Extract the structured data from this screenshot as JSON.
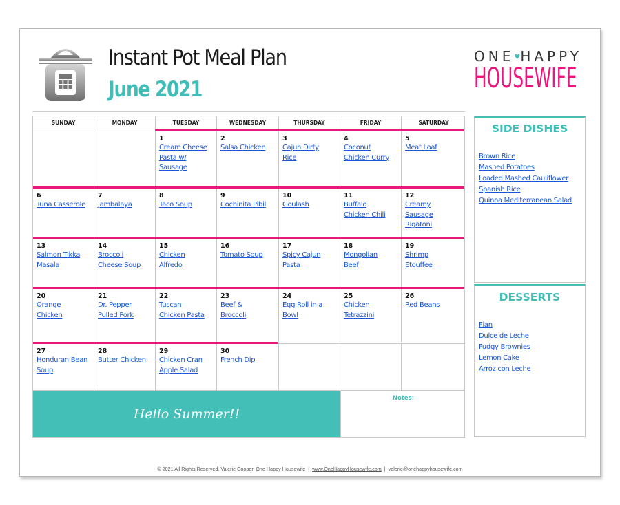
{
  "header": {
    "title": "Instant Pot Meal Plan",
    "subtitle": "June 2021",
    "icon": "instant-pot-icon"
  },
  "logo": {
    "top_left": "ONE",
    "top_right": "HAPPY",
    "heart": "♥",
    "bottom": "HOUSEWIFE"
  },
  "colors": {
    "teal": "#3fbdb6",
    "pink": "#e8187f",
    "link": "#1a56d6"
  },
  "calendar": {
    "days": [
      "SUNDAY",
      "MONDAY",
      "TUESDAY",
      "WEDNESDAY",
      "THURSDAY",
      "FRIDAY",
      "SATURDAY"
    ],
    "weeks": [
      [
        {
          "day": "",
          "meals": []
        },
        {
          "day": "",
          "meals": []
        },
        {
          "day": "1",
          "meals": [
            "Cream Cheese",
            "Pasta w/",
            "Sausage"
          ]
        },
        {
          "day": "2",
          "meals": [
            "Salsa Chicken"
          ]
        },
        {
          "day": "3",
          "meals": [
            "Cajun Dirty",
            "Rice"
          ]
        },
        {
          "day": "4",
          "meals": [
            "Coconut",
            "Chicken Curry"
          ]
        },
        {
          "day": "5",
          "meals": [
            "Meat Loaf"
          ]
        }
      ],
      [
        {
          "day": "6",
          "meals": [
            "Tuna Casserole"
          ]
        },
        {
          "day": "7",
          "meals": [
            "Jambalaya"
          ]
        },
        {
          "day": "8",
          "meals": [
            "Taco Soup"
          ]
        },
        {
          "day": "9",
          "meals": [
            "Cochinita Pibil"
          ]
        },
        {
          "day": "10",
          "meals": [
            "Goulash"
          ]
        },
        {
          "day": "11",
          "meals": [
            "Buffalo",
            "Chicken Chili"
          ]
        },
        {
          "day": "12",
          "meals": [
            "Creamy",
            "Sausage",
            "Rigatoni"
          ]
        }
      ],
      [
        {
          "day": "13",
          "meals": [
            "Salmon Tikka",
            "Masala"
          ]
        },
        {
          "day": "14",
          "meals": [
            "Broccoli",
            "Cheese Soup"
          ]
        },
        {
          "day": "15",
          "meals": [
            "Chicken",
            "Alfredo"
          ]
        },
        {
          "day": "16",
          "meals": [
            "Tomato Soup"
          ]
        },
        {
          "day": "17",
          "meals": [
            "Spicy Cajun",
            "Pasta"
          ]
        },
        {
          "day": "18",
          "meals": [
            "Mongolian",
            "Beef"
          ]
        },
        {
          "day": "19",
          "meals": [
            "Shrimp",
            "Etouffee"
          ]
        }
      ],
      [
        {
          "day": "20",
          "meals": [
            "Orange",
            "Chicken"
          ]
        },
        {
          "day": "21",
          "meals": [
            "Dr. Pepper",
            "Pulled Pork"
          ]
        },
        {
          "day": "22",
          "meals": [
            "Tuscan",
            "Chicken Pasta"
          ]
        },
        {
          "day": "23",
          "meals": [
            "Beef &",
            "Broccoli"
          ]
        },
        {
          "day": "24",
          "meals": [
            "Egg Roll in a",
            "Bowl"
          ]
        },
        {
          "day": "25",
          "meals": [
            "Chicken",
            "Tetrazzini"
          ]
        },
        {
          "day": "26",
          "meals": [
            "Red Beans"
          ]
        }
      ],
      [
        {
          "day": "27",
          "meals": [
            "Honduran Bean",
            "Soup"
          ]
        },
        {
          "day": "28",
          "meals": [
            "Butter Chicken"
          ]
        },
        {
          "day": "29",
          "meals": [
            "Chicken Cran",
            "Apple Salad"
          ]
        },
        {
          "day": "30",
          "meals": [
            "French Dip"
          ]
        },
        {
          "day": "",
          "meals": []
        },
        {
          "day": "",
          "meals": []
        },
        {
          "day": "",
          "meals": []
        }
      ]
    ],
    "banner": "Hello Summer!!",
    "notes_label": "Notes:"
  },
  "side_dishes": {
    "title": "SIDE DISHES",
    "items": [
      "Brown Rice",
      "Mashed Potatoes",
      "Loaded Mashed Cauliflower",
      "Spanish Rice",
      "Quinoa Mediterranean Salad"
    ]
  },
  "desserts": {
    "title": "DESSERTS",
    "items": [
      "Flan",
      "Dulce de Leche",
      "Fudgy Brownies",
      "Lemon Cake",
      "Arroz con Leche"
    ]
  },
  "footer": {
    "copyright": "© 2021 All Rights Reserved, Valerie Cooper, One Happy Housewife",
    "separator": "|",
    "website": "www.OneHappyHousewife.com",
    "email": "valerie@onehappyhousewife.com"
  }
}
